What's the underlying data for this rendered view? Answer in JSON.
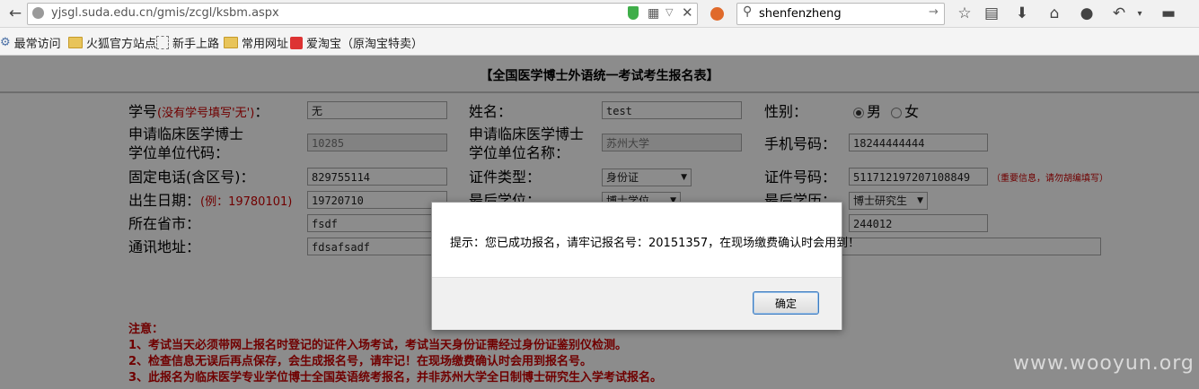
{
  "browser": {
    "url": "yjsgl.suda.edu.cn/gmis/zcgl/ksbm.aspx",
    "search_query": "shenfenzheng",
    "bookmarks": [
      "最常访问",
      "火狐官方站点",
      "新手上路",
      "常用网址",
      "爱淘宝（原淘宝特卖）"
    ],
    "icons": [
      "back-arrow-icon",
      "globe-icon",
      "shield-icon",
      "qr-icon",
      "dropdown-icon",
      "stop-icon",
      "addon-icon",
      "search-icon",
      "go-arrow-icon",
      "star-icon",
      "reading-list-icon",
      "download-icon",
      "home-icon",
      "chat-icon",
      "undo-icon",
      "menu-icon",
      "comment-icon"
    ]
  },
  "form": {
    "title": "【全国医学博士外语统一考试考生报名表】",
    "student_id_label": "学号",
    "student_id_hint": "(没有学号填写'无')",
    "student_id_suffix": "：",
    "student_id_value": "无",
    "name_label": "姓名：",
    "name_value": "test",
    "gender_label": "性别：",
    "gender_male": "男",
    "gender_female": "女",
    "gender_selected": "男",
    "unit_code_label_1": "申请临床医学博士",
    "unit_code_label_2": "学位单位代码：",
    "unit_code_value": "10285",
    "unit_name_label_1": "申请临床医学博士",
    "unit_name_label_2": "学位单位名称：",
    "unit_name_value": "苏州大学",
    "phone_label": "手机号码：",
    "phone_value": "18244444444",
    "landline_label": "固定电话(含区号)：",
    "landline_value": "829755114",
    "id_type_label": "证件类型：",
    "id_type_value": "身份证",
    "id_number_label": "证件号码：",
    "id_number_value": "511712197207108849",
    "id_number_note": "（重要信息，请勿胡编填写）",
    "birth_label": "出生日期：",
    "birth_example": "(例：19780101)",
    "birth_value": "19720710",
    "degree_label": "最后学位：",
    "degree_value": "博士学位",
    "education_label": "最后学历：",
    "education_value": "博士研究生",
    "province_label": "所在省市：",
    "province_value": "fsdf",
    "postcode_value": "244012",
    "address_label": "通讯地址：",
    "address_value": "fdsafsadf"
  },
  "notes": {
    "heading": "注意：",
    "items": [
      "1、考试当天必须带网上报名时登记的证件入场考试，考试当天身份证需经过身份证鉴别仪检测。",
      "2、检查信息无误后再点保存，会生成报名号，请牢记！在现场缴费确认时会用到报名号。",
      "3、此报名为临床医学专业学位博士全国英语统考报名，并非苏州大学全日制博士研究生入学考试报名。"
    ]
  },
  "dialog": {
    "message": "提示：您已成功报名，请牢记报名号：20151357，在现场缴费确认时会用到！",
    "ok_label": "确定"
  },
  "watermark": "www.wooyun.org"
}
